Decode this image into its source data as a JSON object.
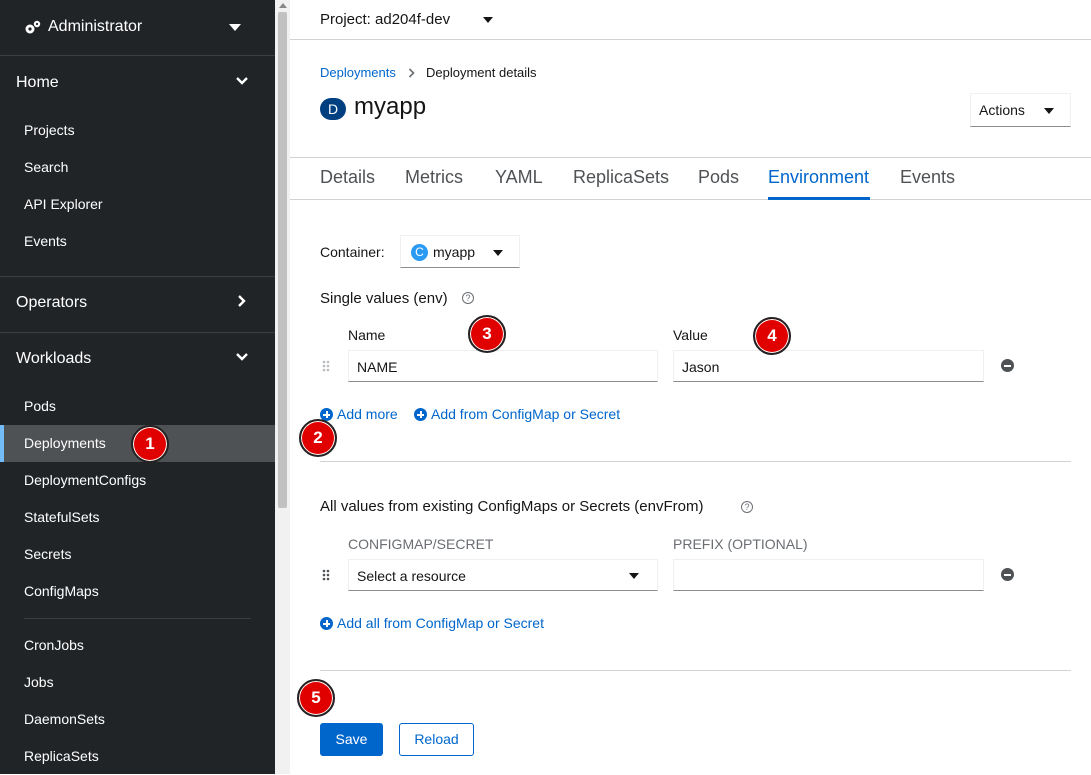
{
  "sidebar": {
    "perspective": "Administrator",
    "sections": {
      "home": "Home",
      "operators": "Operators",
      "workloads": "Workloads"
    },
    "home_items": [
      "Projects",
      "Search",
      "API Explorer",
      "Events"
    ],
    "workload_items": [
      "Pods",
      "Deployments",
      "DeploymentConfigs",
      "StatefulSets",
      "Secrets",
      "ConfigMaps"
    ],
    "workload_items_2": [
      "CronJobs",
      "Jobs",
      "DaemonSets",
      "ReplicaSets"
    ],
    "active_item": "Deployments"
  },
  "header": {
    "project": "Project: ad204f-dev"
  },
  "breadcrumb": {
    "link": "Deployments",
    "current": "Deployment details"
  },
  "resource": {
    "badge": "D",
    "name": "myapp",
    "actions_label": "Actions"
  },
  "tabs": [
    "Details",
    "Metrics",
    "YAML",
    "ReplicaSets",
    "Pods",
    "Environment",
    "Events"
  ],
  "active_tab": "Environment",
  "environment": {
    "container_label": "Container:",
    "container_badge": "C",
    "container_value": "myapp",
    "single_values_title": "Single values (env)",
    "name_header": "Name",
    "value_header": "Value",
    "env_name": "NAME",
    "env_value": "Jason",
    "add_more": "Add more",
    "add_from": "Add from ConfigMap or Secret",
    "envfrom_title": "All values from existing ConfigMaps or Secrets (envFrom)",
    "configmap_header": "CONFIGMAP/SECRET",
    "prefix_header": "PREFIX (OPTIONAL)",
    "resource_placeholder": "Select a resource",
    "prefix_value": "",
    "add_all": "Add all from ConfigMap or Secret",
    "help_glyph": "?"
  },
  "buttons": {
    "save": "Save",
    "reload": "Reload"
  },
  "markers": [
    "1",
    "2",
    "3",
    "4",
    "5"
  ],
  "colors": {
    "sidebar_bg": "#212427",
    "accent": "#0066cc",
    "marker": "#e00000"
  }
}
